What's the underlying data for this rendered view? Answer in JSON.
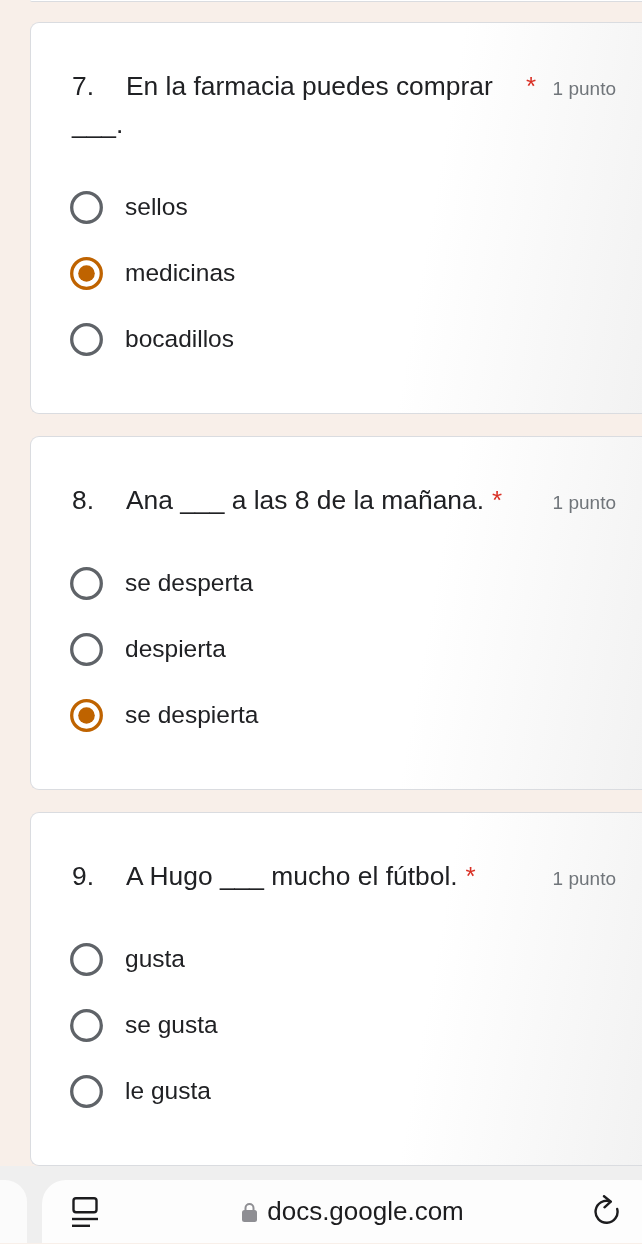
{
  "questions": [
    {
      "title": "7.\tEn la farmacia puedes comprar ___.",
      "required_mark": "*",
      "points": "1 punto",
      "options": [
        {
          "label": "sellos",
          "selected": false
        },
        {
          "label": "medicinas",
          "selected": true
        },
        {
          "label": "bocadillos",
          "selected": false
        }
      ]
    },
    {
      "title": "8.\tAna ___ a las 8 de la mañana.",
      "required_mark": "*",
      "points": "1 punto",
      "options": [
        {
          "label": "se desperta",
          "selected": false
        },
        {
          "label": "despierta",
          "selected": false
        },
        {
          "label": "se despierta",
          "selected": true
        }
      ]
    },
    {
      "title": "9.\tA Hugo ___ mucho el fútbol.",
      "required_mark": "*",
      "points": "1 punto",
      "options": [
        {
          "label": "gusta",
          "selected": false
        },
        {
          "label": "se gusta",
          "selected": false
        },
        {
          "label": "le gusta",
          "selected": false
        }
      ]
    }
  ],
  "browser_bar": {
    "url": "docs.google.com"
  }
}
